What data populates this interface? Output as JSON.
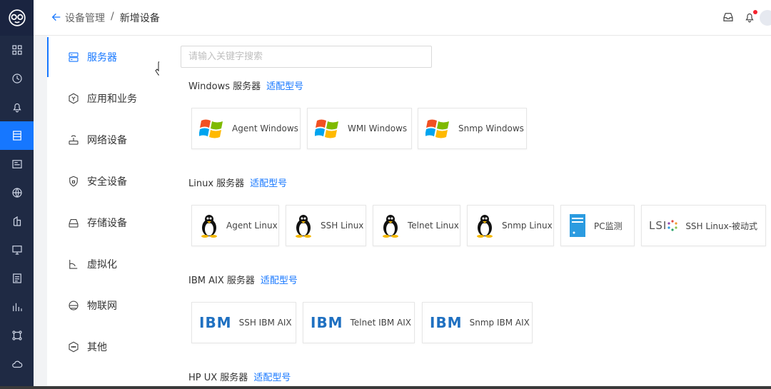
{
  "header": {
    "breadcrumb": [
      "设备管理",
      "/",
      "新增设备"
    ]
  },
  "categories": [
    {
      "label": "服务器",
      "icon": "server-icon"
    },
    {
      "label": "应用和业务",
      "icon": "app-icon"
    },
    {
      "label": "网络设备",
      "icon": "router-icon"
    },
    {
      "label": "安全设备",
      "icon": "shield-icon"
    },
    {
      "label": "存储设备",
      "icon": "storage-icon"
    },
    {
      "label": "虚拟化",
      "icon": "virtual-icon"
    },
    {
      "label": "物联网",
      "icon": "iot-icon"
    },
    {
      "label": "其他",
      "icon": "other-icon"
    }
  ],
  "search": {
    "placeholder": "请输入关键字搜索"
  },
  "sections": [
    {
      "title": "Windows 服务器",
      "link": "适配型号",
      "items": [
        "Agent Windows",
        "WMI Windows",
        "Snmp Windows"
      ]
    },
    {
      "title": "Linux 服务器",
      "link": "适配型号",
      "items": [
        "Agent Linux",
        "SSH Linux",
        "Telnet Linux",
        "Snmp Linux",
        "PC监测",
        "SSH Linux-被动式"
      ]
    },
    {
      "title": "IBM AIX 服务器",
      "link": "适配型号",
      "items": [
        "SSH IBM AIX",
        "Telnet IBM AIX",
        "Snmp IBM AIX"
      ]
    },
    {
      "title": "HP UX 服务器",
      "link": "适配型号",
      "items": []
    }
  ],
  "logos": {
    "ibm": "IBM",
    "lsi": "LSI"
  },
  "colors": {
    "accent": "#1677ff",
    "rail": "#1f2a44"
  }
}
